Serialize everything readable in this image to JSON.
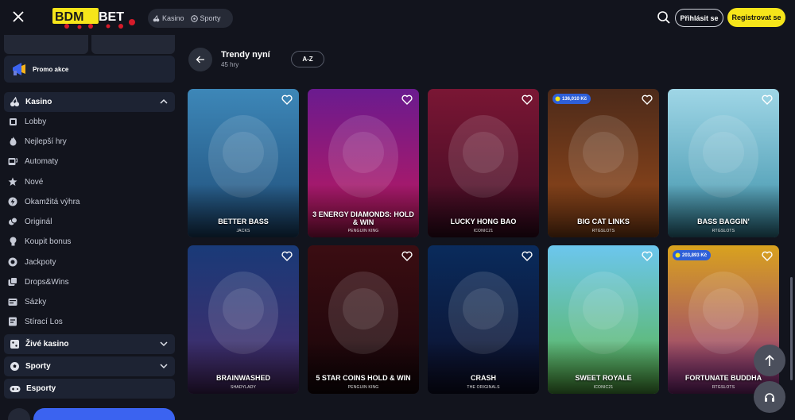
{
  "header": {
    "logo_text": "BDMBET",
    "nav": [
      {
        "label": "Kasino"
      },
      {
        "label": "Sporty"
      }
    ],
    "login_label": "Přihlásit se",
    "register_label": "Registrovat se"
  },
  "sidebar": {
    "promo_label": "Promo akce",
    "kasino": {
      "label": "Kasino",
      "items": [
        {
          "label": "Lobby",
          "icon": "lobby-icon"
        },
        {
          "label": "Nejlepší hry",
          "icon": "flame-icon"
        },
        {
          "label": "Automaty",
          "icon": "slot-machine-icon"
        },
        {
          "label": "Nové",
          "icon": "star-icon"
        },
        {
          "label": "Okamžitá výhra",
          "icon": "lightning-icon"
        },
        {
          "label": "Originál",
          "icon": "original-icon"
        },
        {
          "label": "Koupit bonus",
          "icon": "bonus-icon"
        },
        {
          "label": "Jackpoty",
          "icon": "jackpot-icon"
        },
        {
          "label": "Drops&Wins",
          "icon": "drops-icon"
        },
        {
          "label": "Sázky",
          "icon": "bets-icon"
        },
        {
          "label": "Stírací Los",
          "icon": "scratch-icon"
        }
      ]
    },
    "live": {
      "label": "Živé kasino"
    },
    "sports": {
      "label": "Sporty"
    },
    "esports": {
      "label": "Esporty"
    }
  },
  "main": {
    "title": "Trendy nyní",
    "count": "45 hry",
    "sort_label": "A-Z",
    "games": [
      {
        "name": "BETTER BASS",
        "provider": "JACKS",
        "jackpot": "",
        "colors": [
          "#3d87b8",
          "#1e4b76"
        ]
      },
      {
        "name": "3 ENERGY DIAMONDS: HOLD & WIN",
        "provider": "PENGUIN KING",
        "jackpot": "",
        "colors": [
          "#6a1b8f",
          "#c2185b"
        ]
      },
      {
        "name": "LUCKY HONG BAO",
        "provider": "ICONIC21",
        "jackpot": "",
        "colors": [
          "#7a1634",
          "#3c0b22"
        ]
      },
      {
        "name": "BIG CAT LINKS",
        "provider": "RTGSLOTS",
        "jackpot": "136,010 Kč",
        "colors": [
          "#4c2a1a",
          "#9a4b1a"
        ]
      },
      {
        "name": "BASS BAGGIN'",
        "provider": "RTGSLOTS",
        "jackpot": "",
        "colors": [
          "#9fd6e6",
          "#3a8fa8"
        ]
      },
      {
        "name": "BRAINWASHED",
        "provider": "SHADYLADY",
        "jackpot": "",
        "colors": [
          "#193a78",
          "#4b2a6a"
        ]
      },
      {
        "name": "5 STAR COINS HOLD & WIN",
        "provider": "PENGUIN KING",
        "jackpot": "",
        "colors": [
          "#3b0d12",
          "#170509"
        ]
      },
      {
        "name": "CRASH",
        "provider": "THE ORIGINALS",
        "jackpot": "",
        "colors": [
          "#0a2b5c",
          "#0d0f2a"
        ]
      },
      {
        "name": "SWEET ROYALE",
        "provider": "ICONIC21",
        "jackpot": "",
        "colors": [
          "#6cc6ee",
          "#58b548"
        ]
      },
      {
        "name": "FORTUNATE BUDDHA",
        "provider": "RTGSLOTS",
        "jackpot": "203,893 Kč",
        "colors": [
          "#d9a21e",
          "#8c2e8a"
        ]
      }
    ]
  }
}
